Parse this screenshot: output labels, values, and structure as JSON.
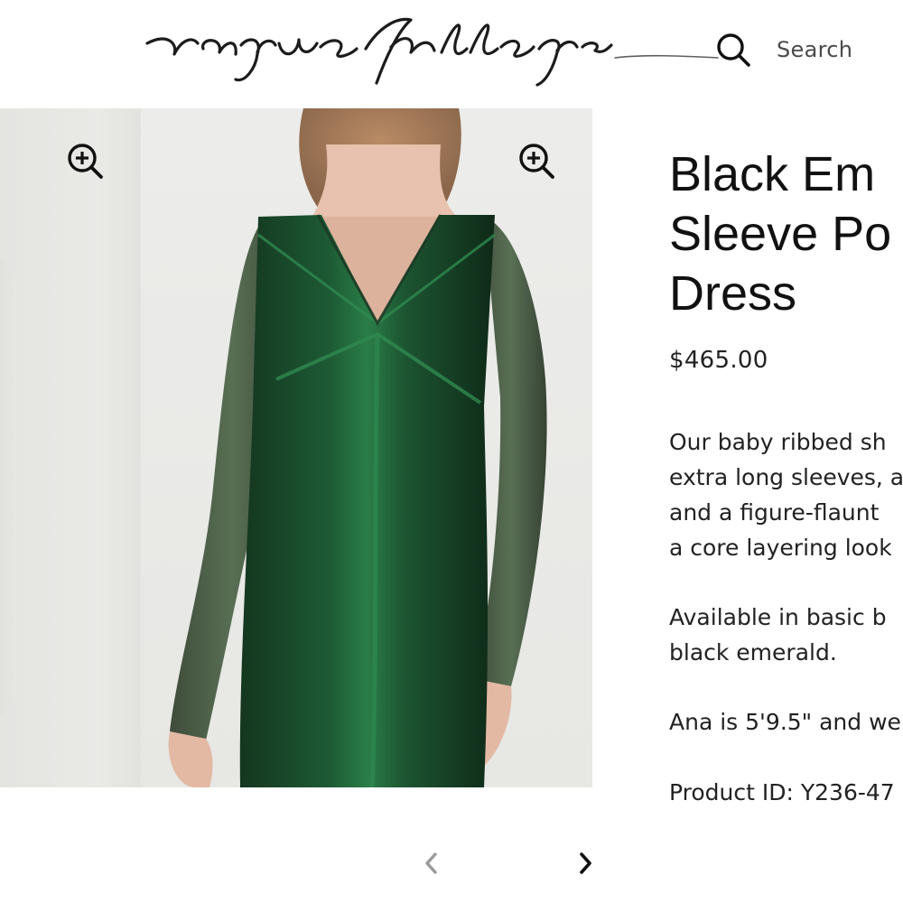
{
  "header": {
    "search_label": "Search",
    "logo_text": "raquel allegra"
  },
  "gallery": {
    "zoom_icon": "zoom-in-icon",
    "prev_icon": "chevron-left-icon",
    "next_icon": "chevron-right-icon"
  },
  "product": {
    "title_line1": "Black Em",
    "title_line2": "Sleeve Po",
    "title_line3": "Dress",
    "price": "$465.00",
    "desc_line1": "Our baby ribbed sh",
    "desc_line2": "extra long sleeves, a",
    "desc_line3": "and a figure-flaunt",
    "desc_line4": "a core layering look",
    "avail_line1": "Available in basic b",
    "avail_line2": "black emerald.",
    "model_line": "Ana is 5'9.5\" and we",
    "product_id": "Product ID: Y236-47"
  },
  "colors": {
    "dress_green": "#1f5a38",
    "background": "#ffffff",
    "gallery_bg": "#e9e9e6",
    "text": "#222222"
  }
}
